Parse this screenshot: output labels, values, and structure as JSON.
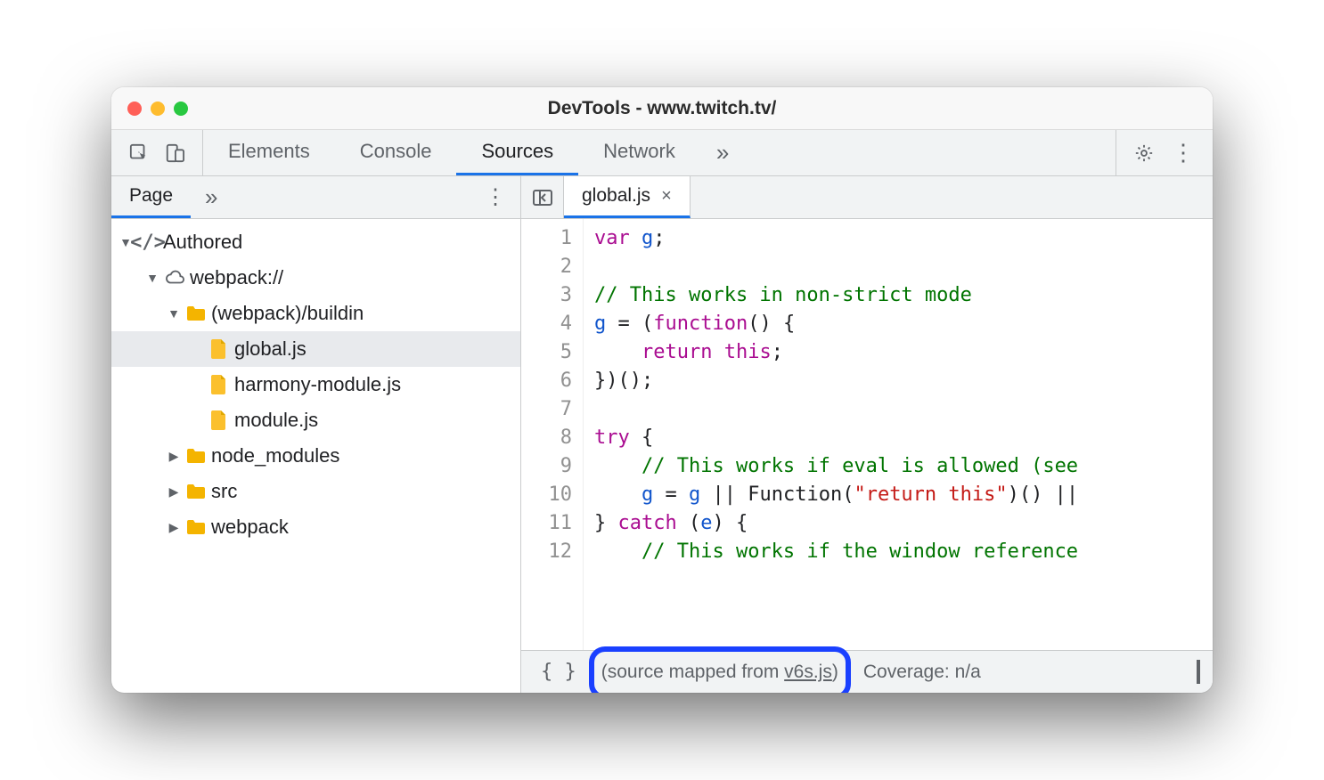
{
  "window": {
    "title": "DevTools - www.twitch.tv/"
  },
  "toolbar": {
    "tabs": [
      "Elements",
      "Console",
      "Sources",
      "Network"
    ],
    "active_tab": "Sources",
    "overflow_glyph": "»"
  },
  "sidebar": {
    "tab_label": "Page",
    "overflow_glyph": "»",
    "tree": {
      "root_label": "Authored",
      "webpack_label": "webpack://",
      "buildin_label": "(webpack)/buildin",
      "files": [
        "global.js",
        "harmony-module.js",
        "module.js"
      ],
      "folders": [
        "node_modules",
        "src",
        "webpack"
      ],
      "selected_file": "global.js"
    }
  },
  "editor": {
    "open_tab": "global.js",
    "code_lines": [
      {
        "n": 1,
        "html": "<span class='kw'>var</span> <span class='id-g'>g</span><span class='pn'>;</span>"
      },
      {
        "n": 2,
        "html": ""
      },
      {
        "n": 3,
        "html": "<span class='cm'>// This works in non-strict mode</span>"
      },
      {
        "n": 4,
        "html": "<span class='id-g'>g</span> <span class='pn'>= (</span><span class='fn'>function</span><span class='pn'>() {</span>"
      },
      {
        "n": 5,
        "html": "    <span class='kw'>return</span> <span class='kw'>this</span><span class='pn'>;</span>"
      },
      {
        "n": 6,
        "html": "<span class='pn'>})();</span>"
      },
      {
        "n": 7,
        "html": ""
      },
      {
        "n": 8,
        "html": "<span class='kw'>try</span> <span class='pn'>{</span>"
      },
      {
        "n": 9,
        "html": "    <span class='cm'>// This works if eval is allowed (see</span>"
      },
      {
        "n": 10,
        "html": "    <span class='id-g'>g</span> <span class='pn'>=</span> <span class='id-g'>g</span> <span class='pn'>||</span> Function<span class='pn'>(</span><span class='str'>\"return this\"</span><span class='pn'>)() ||</span>"
      },
      {
        "n": 11,
        "html": "<span class='pn'>}</span> <span class='kw'>catch</span> <span class='pn'>(</span><span class='id-g'>e</span><span class='pn'>) {</span>"
      },
      {
        "n": 12,
        "html": "    <span class='cm'>// This works if the window reference</span>"
      }
    ]
  },
  "statusbar": {
    "braces": "{ }",
    "mapped_prefix": "(source mapped from ",
    "mapped_link": "v6s.js",
    "mapped_suffix": ")",
    "coverage": "Coverage: n/a"
  }
}
